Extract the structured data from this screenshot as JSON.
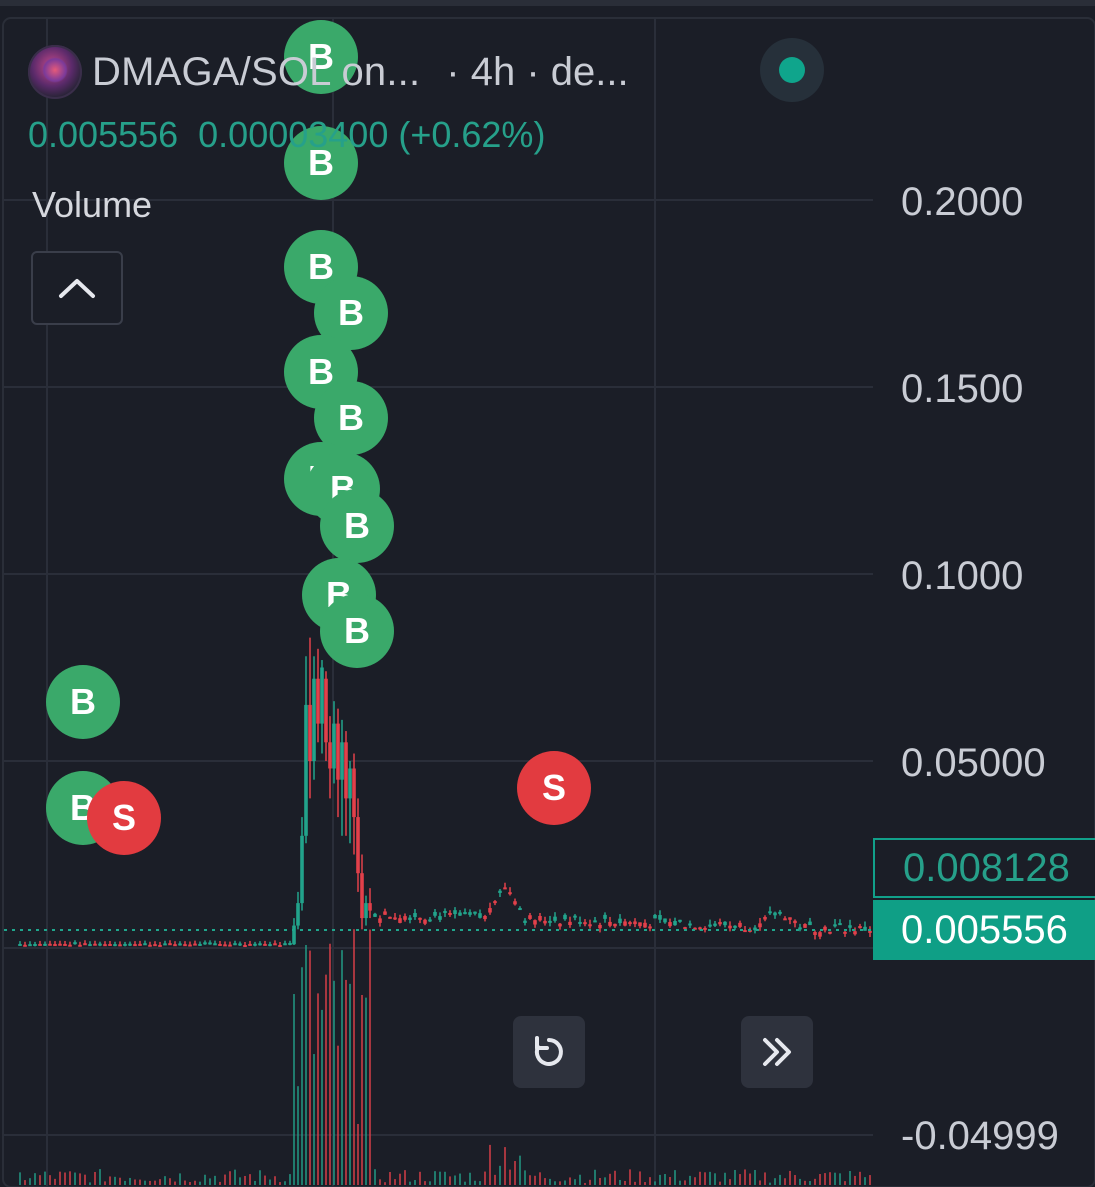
{
  "header": {
    "pair_title": "DMAGA/SOL on...",
    "interval_text": "· 4h · de...",
    "status_color": "#0fa58c"
  },
  "ohlc": {
    "price": "0.005556",
    "change": "0.00003400 (+0.62%)"
  },
  "indicator": {
    "volume_label": "Volume",
    "collapse_icon": "chevron-up-icon"
  },
  "price_scale": {
    "labels": [
      "0.2000",
      "0.1500",
      "0.1000",
      "0.05000",
      "-0.04999"
    ],
    "tag_outline": "0.008128",
    "tag_filled": "0.005556"
  },
  "controls": {
    "reset_icon": "reset-icon",
    "scroll_icon": "double-chevron-right-icon"
  },
  "colors": {
    "up": "#22a38b",
    "down": "#e2404a",
    "buy_marker": "#3aa96a",
    "sell_marker": "#e23b40",
    "grid": "#2a2e39",
    "background": "#1b1e27"
  },
  "markers": [
    {
      "type": "buy",
      "label": "B"
    },
    {
      "type": "buy",
      "label": "B"
    },
    {
      "type": "buy",
      "label": "B"
    },
    {
      "type": "buy",
      "label": "B"
    },
    {
      "type": "buy",
      "label": "B"
    },
    {
      "type": "buy",
      "label": "B"
    },
    {
      "type": "buy",
      "label": "B"
    },
    {
      "type": "buy",
      "label": "B"
    },
    {
      "type": "buy",
      "label": "B"
    },
    {
      "type": "buy",
      "label": "B"
    },
    {
      "type": "buy",
      "label": "B"
    },
    {
      "type": "buy",
      "label": "B"
    },
    {
      "type": "buy",
      "label": "B"
    },
    {
      "type": "sell",
      "label": "S"
    },
    {
      "type": "sell",
      "label": "S"
    }
  ],
  "chart_data": {
    "type": "candlestick",
    "y_axis_ticks": [
      0.2,
      0.15,
      0.1,
      0.05,
      -0.04999
    ],
    "last_price": 0.005556,
    "reference_price": 0.008128
  }
}
